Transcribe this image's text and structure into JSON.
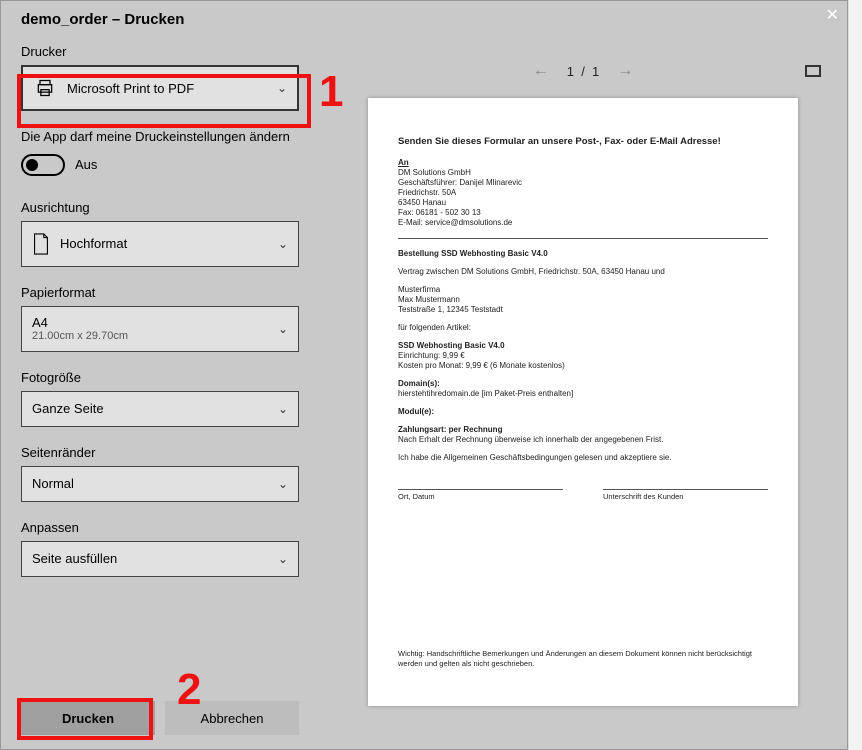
{
  "title": "demo_order – Drucken",
  "annotations": {
    "mark1": "1",
    "mark2": "2"
  },
  "printer": {
    "label": "Drucker",
    "selected": "Microsoft Print to PDF"
  },
  "permission": {
    "text": "Die App darf meine Druckeinstellungen ändern",
    "state_label": "Aus"
  },
  "orientation": {
    "label": "Ausrichtung",
    "selected": "Hochformat"
  },
  "paper": {
    "label": "Papierformat",
    "selected": "A4",
    "sub": "21.00cm x 29.70cm"
  },
  "photo_size": {
    "label": "Fotogröße",
    "selected": "Ganze Seite"
  },
  "margins": {
    "label": "Seitenränder",
    "selected": "Normal"
  },
  "fit": {
    "label": "Anpassen",
    "selected": "Seite ausfüllen"
  },
  "buttons": {
    "print": "Drucken",
    "cancel": "Abbrechen"
  },
  "pager": {
    "current": "1",
    "sep": "/",
    "total": "1"
  },
  "preview": {
    "headline": "Senden Sie dieses Formular an unsere Post-, Fax- oder E-Mail Adresse!",
    "an_label": "An",
    "company": "DM Solutions GmbH",
    "manager": "Geschäftsführer: Danijel Mlinarevic",
    "street": "Friedrichstr. 50A",
    "city": "63450 Hanau",
    "fax": "Fax: 06181 - 502 30 13",
    "email": "E-Mail: service@dmsolutions.de",
    "order_title": "Bestellung SSD Webhosting Basic V4.0",
    "contract_between": "Vertrag zwischen DM Solutions GmbH, Friedrichstr. 50A, 63450 Hanau und",
    "cust1": "Musterfirma",
    "cust2": "Max Mustermann",
    "cust3": "Teststraße 1, 12345 Teststadt",
    "for_articles": "für folgenden Artikel:",
    "art_name": "SSD Webhosting Basic V4.0",
    "art_setup": "Einrichtung: 9,99 €",
    "art_monthly": "Kosten pro Monat: 9,99 € (6 Monate kostenlos)",
    "domains_h": "Domain(s):",
    "domains_v": "hierstehtihredomain.de [im Paket-Preis enthalten]",
    "modules_h": "Modul(e):",
    "pay_h": "Zahlungsart: per Rechnung",
    "pay_t": "Nach Erhalt der Rechnung überweise ich innerhalb der angegebenen Frist.",
    "accept": "Ich habe die Allgemeinen Geschäftsbedingungen gelesen und akzeptiere sie.",
    "sig_left": "Ort, Datum",
    "sig_right": "Unterschrift des Kunden",
    "note": "Wichtig: Handschriftliche Bemerkungen und Änderungen an diesem Dokument können nicht berücksichtigt werden und gelten als nicht geschrieben."
  }
}
